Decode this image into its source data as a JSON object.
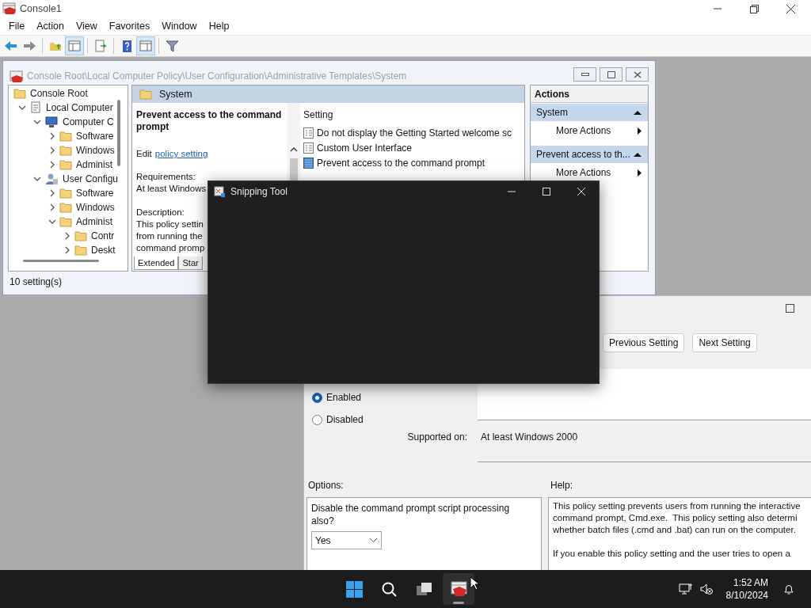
{
  "main_window": {
    "title": "Console1",
    "menu": [
      "File",
      "Action",
      "View",
      "Favorites",
      "Window",
      "Help"
    ],
    "toolbar": [
      {
        "kind": "back",
        "pressed": false
      },
      {
        "kind": "forward",
        "pressed": false
      },
      {
        "kind": "sep"
      },
      {
        "kind": "up",
        "pressed": false
      },
      {
        "kind": "tree",
        "pressed": true
      },
      {
        "kind": "sep"
      },
      {
        "kind": "export",
        "pressed": false
      },
      {
        "kind": "sep"
      },
      {
        "kind": "help",
        "pressed": false
      },
      {
        "kind": "actionpane",
        "pressed": true
      },
      {
        "kind": "sep"
      },
      {
        "kind": "filter",
        "pressed": false
      }
    ]
  },
  "child_window": {
    "title": "Console Root\\Local Computer Policy\\User Configuration\\Administrative Templates\\System",
    "tree": [
      {
        "label": "Console Root",
        "kind": "folder",
        "children": [
          {
            "label": "Local Computer",
            "kind": "policy",
            "expanded": true,
            "children": [
              {
                "label": "Computer C",
                "kind": "computer",
                "expanded": true,
                "children": [
                  {
                    "label": "Software",
                    "kind": "folder",
                    "expanded": false
                  },
                  {
                    "label": "Windows",
                    "kind": "folder",
                    "expanded": false
                  },
                  {
                    "label": "Administ",
                    "kind": "folder",
                    "expanded": false
                  }
                ]
              },
              {
                "label": "User Configu",
                "kind": "user",
                "expanded": true,
                "children": [
                  {
                    "label": "Software",
                    "kind": "folder",
                    "expanded": false
                  },
                  {
                    "label": "Windows",
                    "kind": "folder",
                    "expanded": false
                  },
                  {
                    "label": "Administ",
                    "kind": "folder",
                    "expanded": true,
                    "children": [
                      {
                        "label": "Contr",
                        "kind": "folder",
                        "expanded": false
                      },
                      {
                        "label": "Deskt",
                        "kind": "folder",
                        "expanded": false
                      }
                    ]
                  }
                ]
              }
            ]
          }
        ]
      }
    ],
    "details": {
      "header": "System",
      "policy_title": "Prevent access to the command prompt",
      "edit_prefix": "Edit",
      "edit_link": "policy setting",
      "requirements_label": "Requirements:",
      "requirements": "At least Windows",
      "description_label": "Description:",
      "description_lines": [
        "This policy settin",
        "from running the",
        "command promp"
      ],
      "tabs": [
        {
          "label": "Extended",
          "selected": true
        },
        {
          "label": "Star",
          "selected": false
        }
      ],
      "list_header": "Setting",
      "settings": [
        {
          "name": "Do not display the Getting Started welcome sc",
          "configured": false
        },
        {
          "name": "Custom User Interface",
          "configured": false
        },
        {
          "name": "Prevent access to the command prompt",
          "configured": true
        }
      ]
    },
    "actions": {
      "title": "Actions",
      "sections": [
        {
          "title": "System",
          "expanded": true,
          "items": [
            "More Actions"
          ]
        },
        {
          "title": "Prevent access to th...",
          "expanded": true,
          "items": [
            "More Actions"
          ]
        }
      ]
    },
    "status": "10 setting(s)"
  },
  "policy_dialog": {
    "buttons": [
      "Previous Setting",
      "Next Setting"
    ],
    "states": [
      {
        "label": "Enabled",
        "selected": true
      },
      {
        "label": "Disabled",
        "selected": false
      }
    ],
    "supported_label": "Supported on:",
    "supported": "At least Windows 2000",
    "options_label": "Options:",
    "help_label": "Help:",
    "option_text": "Disable the command prompt script processing also?",
    "option_value": "Yes",
    "help_paragraphs": [
      [
        "This policy setting prevents users from running the interactive",
        "command prompt, Cmd.exe.  This policy setting also determi",
        "whether batch files (.cmd and .bat) can run on the computer."
      ],
      [
        "If you enable this policy setting and the user tries to open a"
      ]
    ]
  },
  "snipping_tool": {
    "title": "Snipping Tool"
  },
  "taskbar": {
    "apps": [
      {
        "kind": "start",
        "active": false
      },
      {
        "kind": "search",
        "active": false
      },
      {
        "kind": "taskview",
        "active": false
      },
      {
        "kind": "mmc",
        "active": true
      }
    ],
    "time": "1:52 AM",
    "date": "8/10/2024"
  }
}
